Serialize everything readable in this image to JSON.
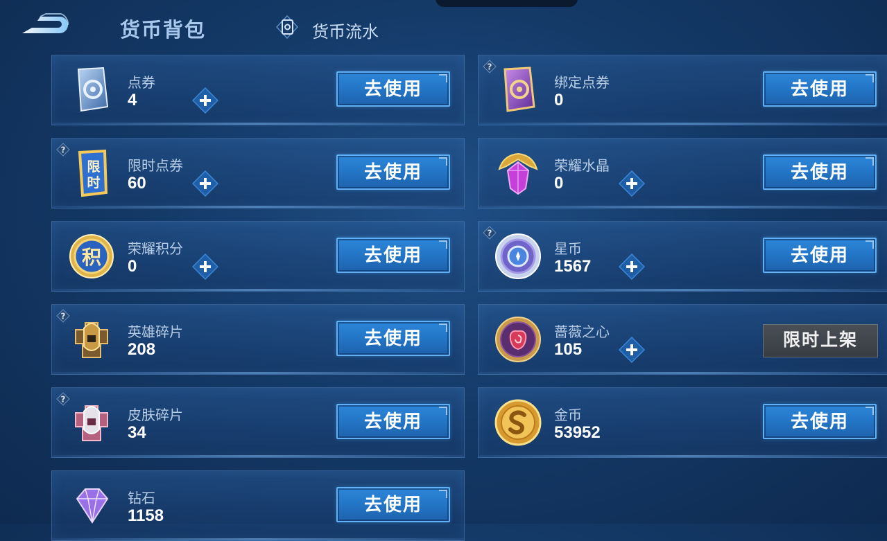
{
  "header": {
    "title": "货币背包",
    "flow_tab_label": "货币流水"
  },
  "items": [
    {
      "name": "点券",
      "count": "4",
      "button": "去使用",
      "icon": "coupon-card-icon"
    },
    {
      "name": "绑定点券",
      "count": "0",
      "button": "去使用",
      "icon": "bound-coupon-card-icon"
    },
    {
      "name": "限时点券",
      "count": "60",
      "button": "去使用",
      "icon": "limited-coupon-icon",
      "icon_text": "限时"
    },
    {
      "name": "荣耀水晶",
      "count": "0",
      "button": "去使用",
      "icon": "glory-crystal-icon"
    },
    {
      "name": "荣耀积分",
      "count": "0",
      "button": "去使用",
      "icon": "glory-points-icon",
      "icon_text": "积"
    },
    {
      "name": "星币",
      "count": "1567",
      "button": "去使用",
      "icon": "star-coin-icon"
    },
    {
      "name": "英雄碎片",
      "count": "208",
      "button": "去使用",
      "icon": "hero-fragment-icon"
    },
    {
      "name": "蔷薇之心",
      "count": "105",
      "button": "限时上架",
      "icon": "rose-heart-icon"
    },
    {
      "name": "皮肤碎片",
      "count": "34",
      "button": "去使用",
      "icon": "skin-fragment-icon"
    },
    {
      "name": "金币",
      "count": "53952",
      "button": "去使用",
      "icon": "gold-coin-icon"
    },
    {
      "name": "钻石",
      "count": "1158",
      "button": "去使用",
      "icon": "diamond-icon"
    }
  ],
  "help_symbol": "?",
  "colors": {
    "accent_button": "#2375c6",
    "card_border": "#6ea0dc",
    "background": "#143a68"
  }
}
